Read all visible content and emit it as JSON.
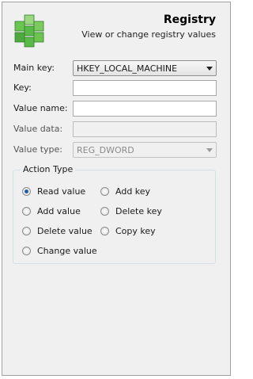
{
  "header": {
    "title": "Registry",
    "subtitle": "View or change registry values",
    "icon": "registry-cubes-icon"
  },
  "form": {
    "main_key": {
      "label": "Main key:",
      "value": "HKEY_LOCAL_MACHINE"
    },
    "key": {
      "label": "Key:",
      "value": ""
    },
    "value_name": {
      "label": "Value name:",
      "value": ""
    },
    "value_data": {
      "label": "Value data:",
      "value": ""
    },
    "value_type": {
      "label": "Value type:",
      "value": "REG_DWORD"
    }
  },
  "action_type": {
    "legend": "Action Type",
    "options": [
      {
        "label": "Read value",
        "selected": true
      },
      {
        "label": "Add key",
        "selected": false
      },
      {
        "label": "Add value",
        "selected": false
      },
      {
        "label": "Delete key",
        "selected": false
      },
      {
        "label": "Delete value",
        "selected": false
      },
      {
        "label": "Copy key",
        "selected": false
      },
      {
        "label": "Change value",
        "selected": false
      }
    ]
  },
  "colors": {
    "accent": "#1c5fa8",
    "icon_green": "#5bb94a"
  }
}
